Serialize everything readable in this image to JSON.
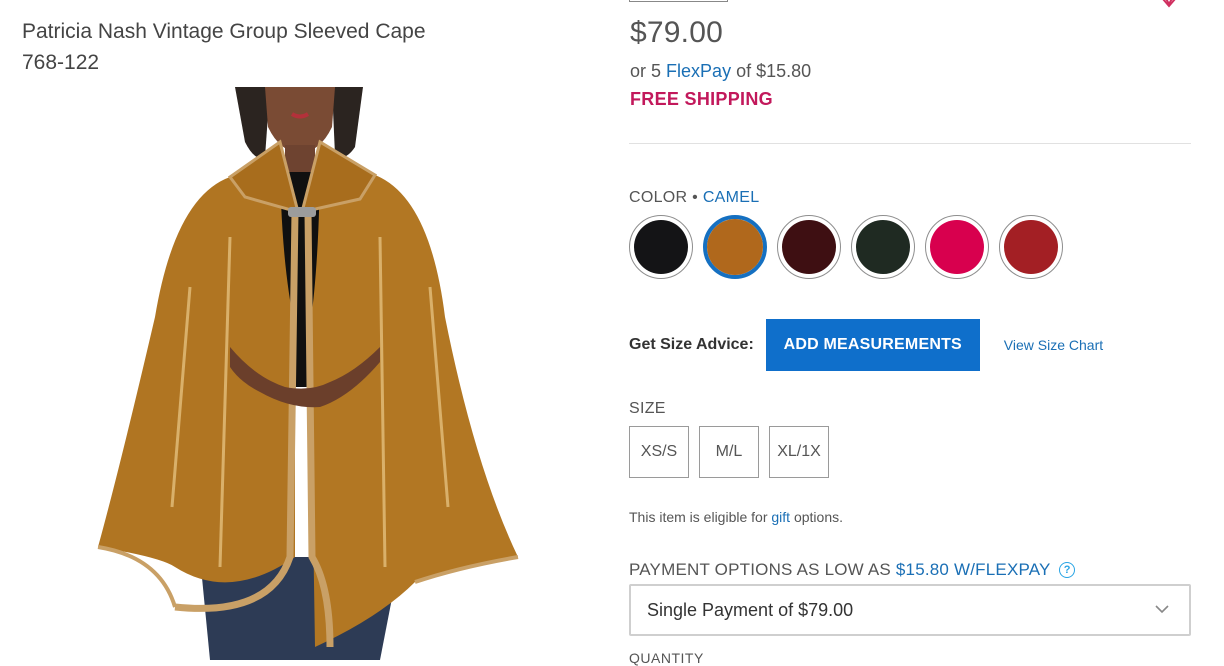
{
  "product": {
    "title": "Patricia Nash Vintage Group Sleeved Cape",
    "item_number": "768-122",
    "price": "$79.00",
    "flexpay_prefix": "or 5",
    "flexpay_link": "FlexPay",
    "flexpay_suffix": "of $15.80",
    "shipping": "FREE SHIPPING"
  },
  "color": {
    "label": "COLOR",
    "separator": "•",
    "selected": "CAMEL",
    "swatches": [
      {
        "name": "black",
        "hex": "#141416"
      },
      {
        "name": "camel",
        "hex": "#b0681c"
      },
      {
        "name": "burgundy",
        "hex": "#3e0f12"
      },
      {
        "name": "dark-green",
        "hex": "#1f2a22"
      },
      {
        "name": "pink",
        "hex": "#d8004e"
      },
      {
        "name": "red",
        "hex": "#a31f24"
      }
    ]
  },
  "size_advice": {
    "label": "Get Size Advice:",
    "button": "ADD MEASUREMENTS",
    "chart_link": "View Size Chart"
  },
  "size": {
    "label": "SIZE",
    "options": [
      "XS/S",
      "M/L",
      "XL/1X"
    ]
  },
  "gift": {
    "prefix": "This item is eligible for",
    "link": "gift",
    "suffix": "options."
  },
  "payment": {
    "label": "PAYMENT OPTIONS AS LOW AS",
    "highlight": "$15.80 W/FLEXPAY",
    "help": "?",
    "selected_option": "Single Payment of $79.00"
  },
  "quantity_label": "QUANTITY"
}
